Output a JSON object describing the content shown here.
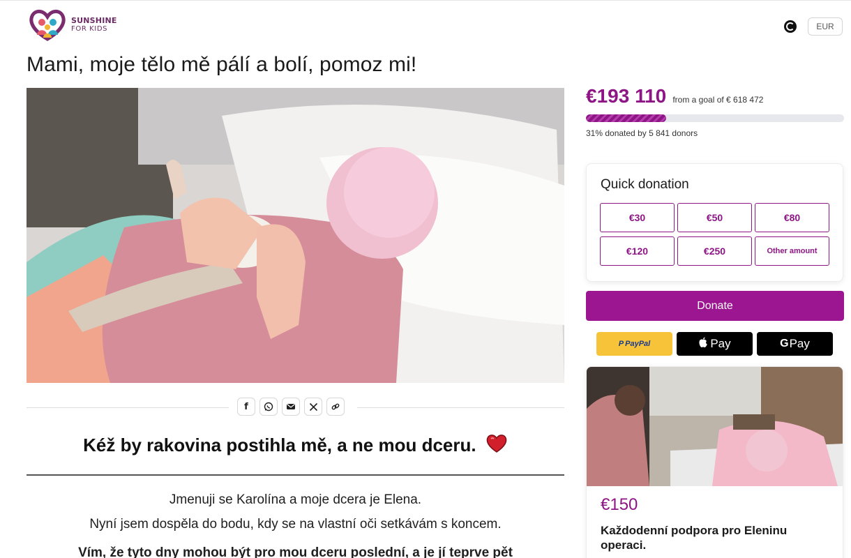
{
  "brand": {
    "name_line1": "SUNSHINE",
    "name_line2": "FOR KIDS"
  },
  "header": {
    "currency": "EUR"
  },
  "campaign": {
    "title": "Mami, moje tělo mě pálí a bolí, pomoz mi!",
    "raised": "€193 110",
    "goal_text": "from a goal of € 618 472",
    "progress_fraction": 0.31,
    "donated_by": "31% donated by 5 841 donors"
  },
  "share": {
    "icons": [
      "facebook-icon",
      "whatsapp-icon",
      "email-icon",
      "x-icon",
      "link-icon"
    ]
  },
  "story": {
    "heading": "Kéž by rakovina postihla mě, a ne mou dceru.",
    "paragraphs": [
      "Jmenuji se Karolína a moje dcera je Elena.",
      "Nyní jsem dospěla do bodu, kdy se na vlastní oči setkávám s koncem.",
      "Vím, že tyto dny mohou být pro mou dceru poslední, a je jí teprve pět"
    ]
  },
  "quick_donation": {
    "title": "Quick donation",
    "amounts": [
      "€30",
      "€50",
      "€80",
      "€120",
      "€250",
      "Other amount"
    ]
  },
  "donate": {
    "label": "Donate"
  },
  "payments": {
    "paypal": "PayPal",
    "apple": "Pay",
    "google": "Pay"
  },
  "reward": {
    "amount": "€150",
    "title": "Každodenní podpora pro Eleninu operaci."
  },
  "colors": {
    "accent": "#8e1585",
    "donate_button": "#9b1690",
    "paypal": "#f7c339"
  }
}
